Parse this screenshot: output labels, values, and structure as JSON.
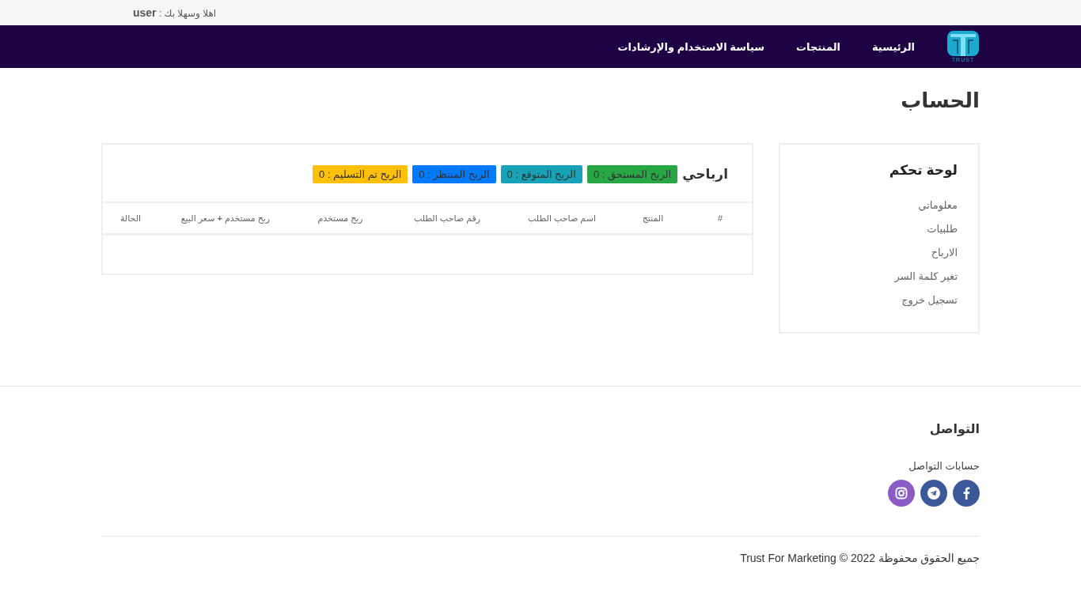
{
  "top_bar": {
    "greeting": "اهلا وسهلا بك : **user**"
  },
  "navbar": {
    "logo_text": "TRUST",
    "links": [
      {
        "label": "الرئيسية"
      },
      {
        "label": "المنتجات"
      },
      {
        "label": "سياسة الاستخدام والإرشادات"
      }
    ]
  },
  "page_title": "الحساب",
  "sidebar": {
    "title": "لوحة تحكم",
    "items": [
      {
        "label": "معلوماتي"
      },
      {
        "label": "طلبيات"
      },
      {
        "label": "الارباح"
      },
      {
        "label": "تغير كلمة السر"
      },
      {
        "label": "تسجيل خروج"
      }
    ]
  },
  "earnings": {
    "title": "ارباحي",
    "badges": [
      {
        "label": "الربح المستحق : 0",
        "color": "#28a745"
      },
      {
        "label": "الربح المتوقع : 0",
        "color": "#17a2b8"
      },
      {
        "label": "الربح المنتظر : 0",
        "color": "#007bff"
      },
      {
        "label": "الربح تم التسليم : 0",
        "color": "#ffc107"
      }
    ]
  },
  "table": {
    "columns": [
      "#",
      "المنتج",
      "اسم صاحب الطلب",
      "رقم صاحب الطلب",
      "ربح مستخدم",
      "ربح مستخدم **+** سعر البيع",
      "الحالة"
    ]
  },
  "footer": {
    "title": "التواصل",
    "subtitle": "حسابات التواصل",
    "social": [
      {
        "kind": "facebook",
        "color": "#3b5998"
      },
      {
        "kind": "telegram",
        "color": "#3b5998"
      },
      {
        "kind": "instagram",
        "color": "#8a5cc4"
      }
    ],
    "copyright": "جميع الحقوق محفوظة 2022 © Trust For Marketing"
  }
}
